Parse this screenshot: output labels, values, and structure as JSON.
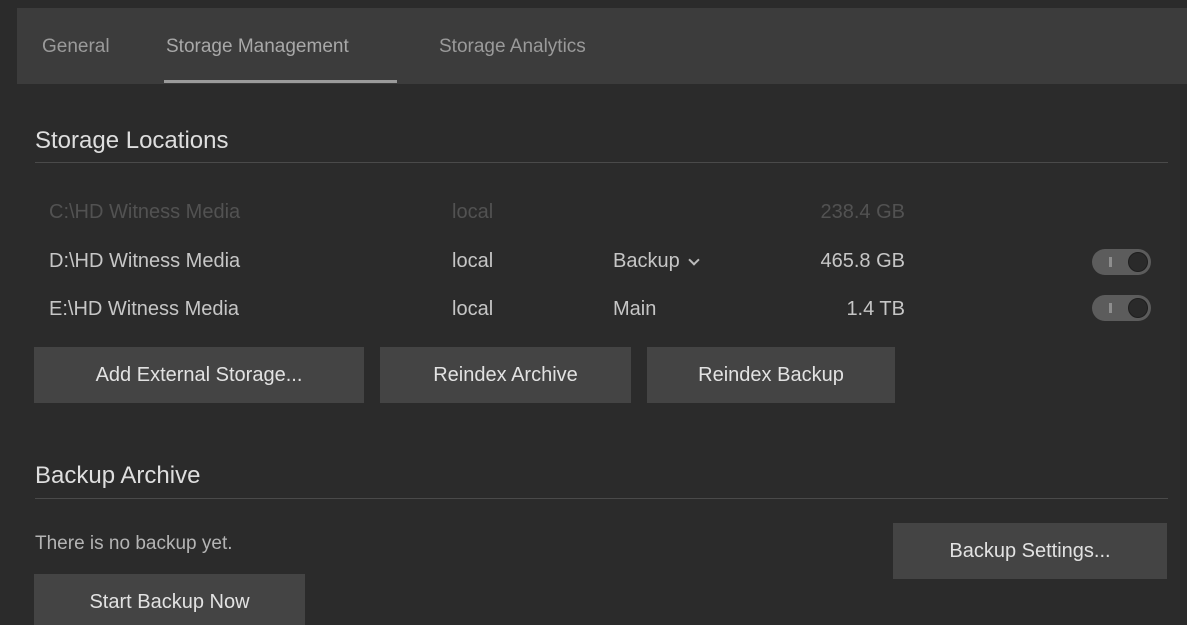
{
  "tabs": [
    {
      "label": "General"
    },
    {
      "label": "Storage Management"
    },
    {
      "label": "Storage Analytics"
    }
  ],
  "active_tab": "Storage Management",
  "storage_locations": {
    "title": "Storage Locations",
    "rows": [
      {
        "path": "C:\\HD Witness Media",
        "type": "local",
        "role": "",
        "size": "238.4 GB",
        "enabled": false,
        "disabled": true
      },
      {
        "path": "D:\\HD Witness Media",
        "type": "local",
        "role": "Backup",
        "size": "465.8 GB",
        "enabled": true,
        "disabled": false
      },
      {
        "path": "E:\\HD Witness Media",
        "type": "local",
        "role": "Main",
        "size": "1.4 TB",
        "enabled": true,
        "disabled": false
      }
    ],
    "buttons": {
      "add_external": "Add External Storage...",
      "reindex_archive": "Reindex Archive",
      "reindex_backup": "Reindex Backup"
    }
  },
  "backup_archive": {
    "title": "Backup Archive",
    "status": "There is no backup yet.",
    "buttons": {
      "settings": "Backup Settings...",
      "start": "Start Backup Now"
    }
  },
  "colors": {
    "background": "#2b2b2b",
    "tabbar": "#3c3c3c",
    "button": "#444444",
    "text": "#c8c8c8"
  }
}
